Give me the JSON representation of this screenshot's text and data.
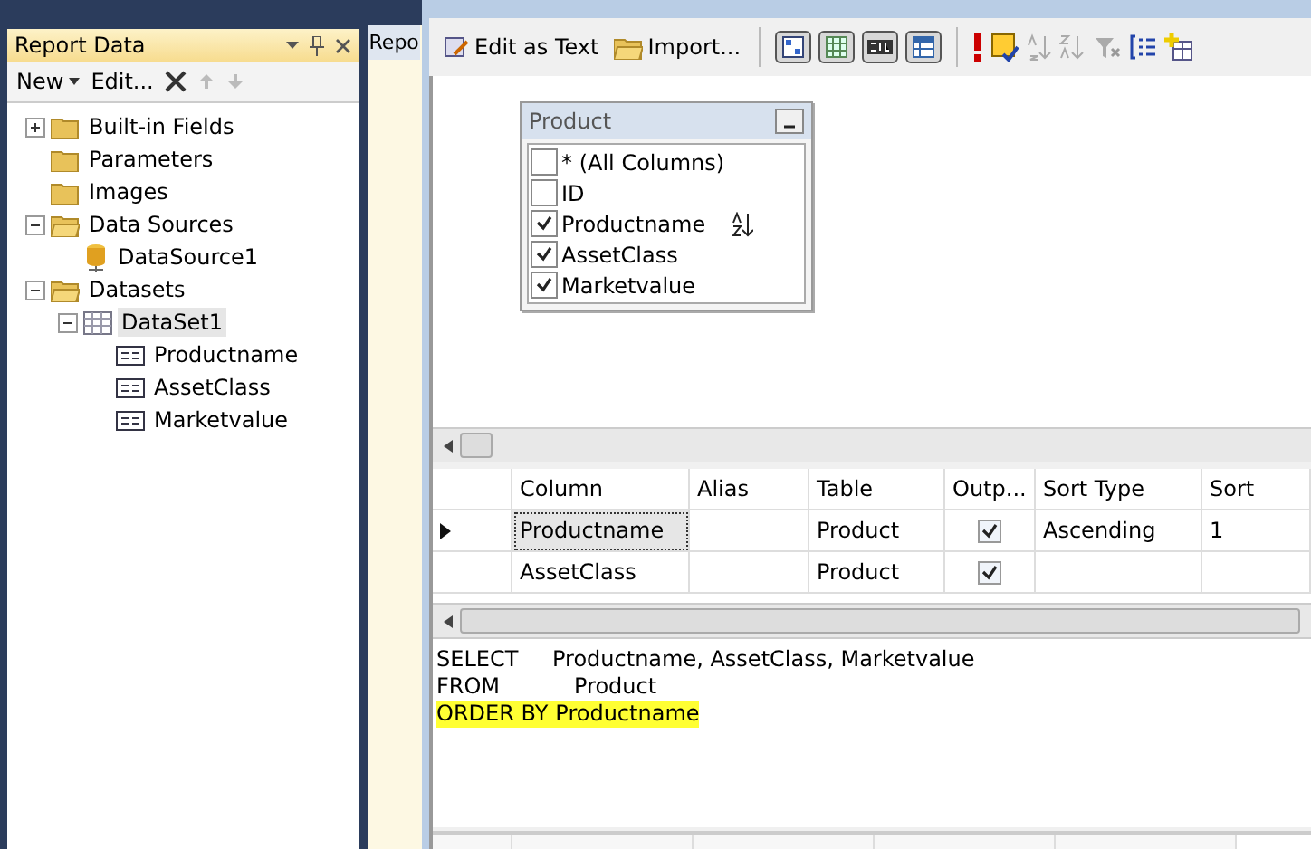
{
  "report_data": {
    "title": "Report Data",
    "toolbar": {
      "new": "New",
      "edit": "Edit..."
    },
    "tree": [
      {
        "label": "Built-in Fields",
        "kind": "folder",
        "expanded": false
      },
      {
        "label": "Parameters",
        "kind": "folder"
      },
      {
        "label": "Images",
        "kind": "folder"
      },
      {
        "label": "Data Sources",
        "kind": "folder",
        "expanded": true,
        "children": [
          {
            "label": "DataSource1",
            "kind": "datasource"
          }
        ]
      },
      {
        "label": "Datasets",
        "kind": "folder",
        "expanded": true,
        "children": [
          {
            "label": "DataSet1",
            "kind": "dataset",
            "expanded": true,
            "selected": true,
            "children": [
              {
                "label": "Productname",
                "kind": "field"
              },
              {
                "label": "AssetClass",
                "kind": "field"
              },
              {
                "label": "Marketvalue",
                "kind": "field"
              }
            ]
          }
        ]
      }
    ]
  },
  "middle_tab": {
    "label": "Repo"
  },
  "query_designer": {
    "toolbar": {
      "edit_as_text": "Edit as Text",
      "import": "Import...",
      "panes": [
        {
          "kind": "diagram",
          "selected": true
        },
        {
          "kind": "grid",
          "selected": true
        },
        {
          "kind": "sql",
          "selected": true
        },
        {
          "kind": "results",
          "selected": true
        }
      ]
    },
    "table": {
      "title": "Product",
      "columns": [
        {
          "label": "* (All Columns)",
          "checked": false,
          "sorted": false
        },
        {
          "label": "ID",
          "checked": false,
          "sorted": false
        },
        {
          "label": "Productname",
          "checked": true,
          "sorted": true
        },
        {
          "label": "AssetClass",
          "checked": true,
          "sorted": false
        },
        {
          "label": "Marketvalue",
          "checked": true,
          "sorted": false
        }
      ]
    },
    "grid": {
      "columns": [
        "Column",
        "Alias",
        "Table",
        "Outp...",
        "Sort Type",
        "Sort"
      ],
      "rows": [
        {
          "column": "Productname",
          "alias": "",
          "table": "Product",
          "output": true,
          "sort_type": "Ascending",
          "sort": "1",
          "current": true
        },
        {
          "column": "AssetClass",
          "alias": "",
          "table": "Product",
          "output": true,
          "sort_type": "",
          "sort": "",
          "current": false
        }
      ]
    },
    "sql": [
      {
        "keyword": "SELECT",
        "text": "Productname, AssetClass, Marketvalue",
        "highlighted": false
      },
      {
        "keyword": "FROM",
        "text": "Product",
        "highlighted": false
      },
      {
        "keyword": "ORDER BY",
        "text": "Productname",
        "highlighted": true
      }
    ]
  }
}
